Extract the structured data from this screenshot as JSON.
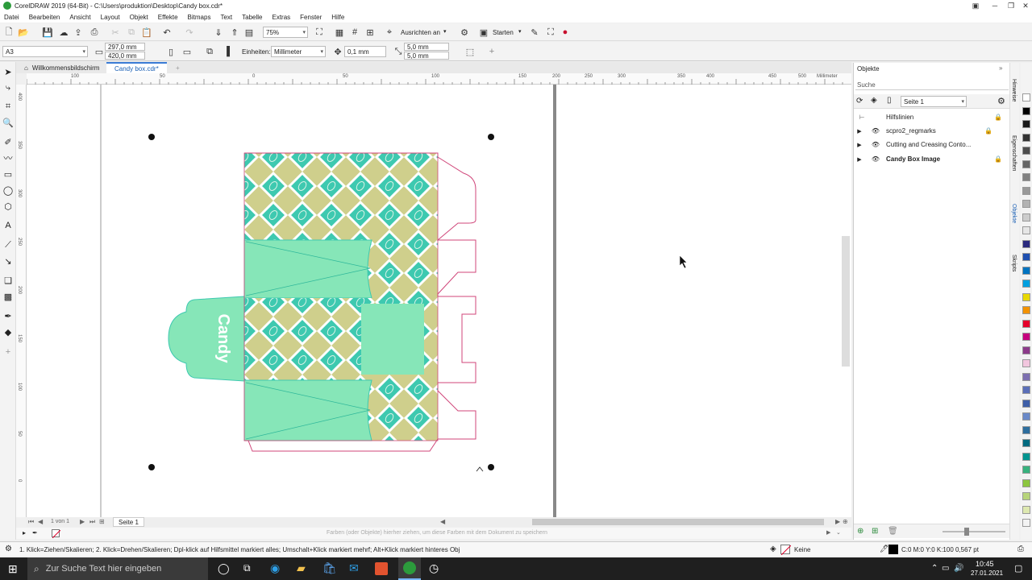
{
  "window": {
    "title": "CorelDRAW 2019 (64-Bit) - C:\\Users\\produktion\\Desktop\\Candy box.cdr*"
  },
  "menu": [
    "Datei",
    "Bearbeiten",
    "Ansicht",
    "Layout",
    "Objekt",
    "Effekte",
    "Bitmaps",
    "Text",
    "Tabelle",
    "Extras",
    "Fenster",
    "Hilfe"
  ],
  "toolbar": {
    "zoom": "75%",
    "snap_label": "Ausrichten an",
    "launch_label": "Starten"
  },
  "propertybar": {
    "page_size": "A3",
    "width": "297,0 mm",
    "height": "420,0 mm",
    "units_label": "Einheiten:",
    "units": "Millimeter",
    "nudge": "0,1 mm",
    "dup_x": "5,0 mm",
    "dup_y": "5,0 mm"
  },
  "tabs": [
    "Willkommensbildschirm",
    "Candy box.cdr*"
  ],
  "ruler": {
    "top": [
      "100",
      "50",
      "0",
      "50",
      "100",
      "150",
      "200",
      "250",
      "300",
      "350",
      "400",
      "450",
      "500"
    ],
    "top_unit": "Millimeter",
    "left": [
      "400",
      "350",
      "300",
      "250",
      "200",
      "150",
      "100",
      "50",
      "0"
    ]
  },
  "artwork": {
    "label": "Candy"
  },
  "page_nav": {
    "counter": "1 von 1",
    "page_tab": "Seite 1",
    "palette_hint": "Farben (oder Objekte) hierher ziehen, um diese Farben mit dem Dokument zu speichern"
  },
  "objects_panel": {
    "title": "Objekte",
    "search_placeholder": "Suche",
    "page": "Seite 1",
    "layers": [
      {
        "name": "Hilfslinien",
        "bold": false
      },
      {
        "name": "scpro2_regmarks",
        "bold": false
      },
      {
        "name": "Cutting and Creasing Conto...",
        "bold": false
      },
      {
        "name": "Candy Box Image",
        "bold": true
      }
    ]
  },
  "side_tabs": [
    "Hinweise",
    "Eigenschaften",
    "Objekte",
    "Skripts"
  ],
  "palette": [
    "#ffffff",
    "#000000",
    "#1a1a1a",
    "#333333",
    "#4d4d4d",
    "#666666",
    "#808080",
    "#999999",
    "#b3b3b3",
    "#cccccc",
    "#e6e6e6",
    "#2b2a7e",
    "#1e4fb0",
    "#0073c0",
    "#00a0e0",
    "#e8d800",
    "#f39200",
    "#e5002b",
    "#c6007e",
    "#8c3a8a",
    "#f2c6de",
    "#7c6fb0",
    "#5b6fb8",
    "#3f5fa8",
    "#6a89c8",
    "#2e6e9e",
    "#006a7f",
    "#00948f",
    "#37b27d",
    "#8cc63f",
    "#b7d47a",
    "#dde8b0",
    "#f3f3f3"
  ],
  "status": {
    "hint": "1. Klick=Ziehen/Skalieren; 2. Klick=Drehen/Skalieren; Dpl-klick auf Hilfsmittel markiert alles; Umschalt+Klick markiert mehrf; Alt+Klick markiert hinteres Obj",
    "fill": "Keine",
    "outline": "C:0 M:0 Y:0 K:100  0,567 pt"
  },
  "taskbar": {
    "search_placeholder": "Zur Suche Text hier eingeben",
    "time": "10:45",
    "date": "27.01.2021"
  },
  "colors": {
    "mint": "#86e6b8",
    "teal": "#3ec9b0",
    "olive": "#cfcf8c",
    "cut": "#d0467a"
  }
}
